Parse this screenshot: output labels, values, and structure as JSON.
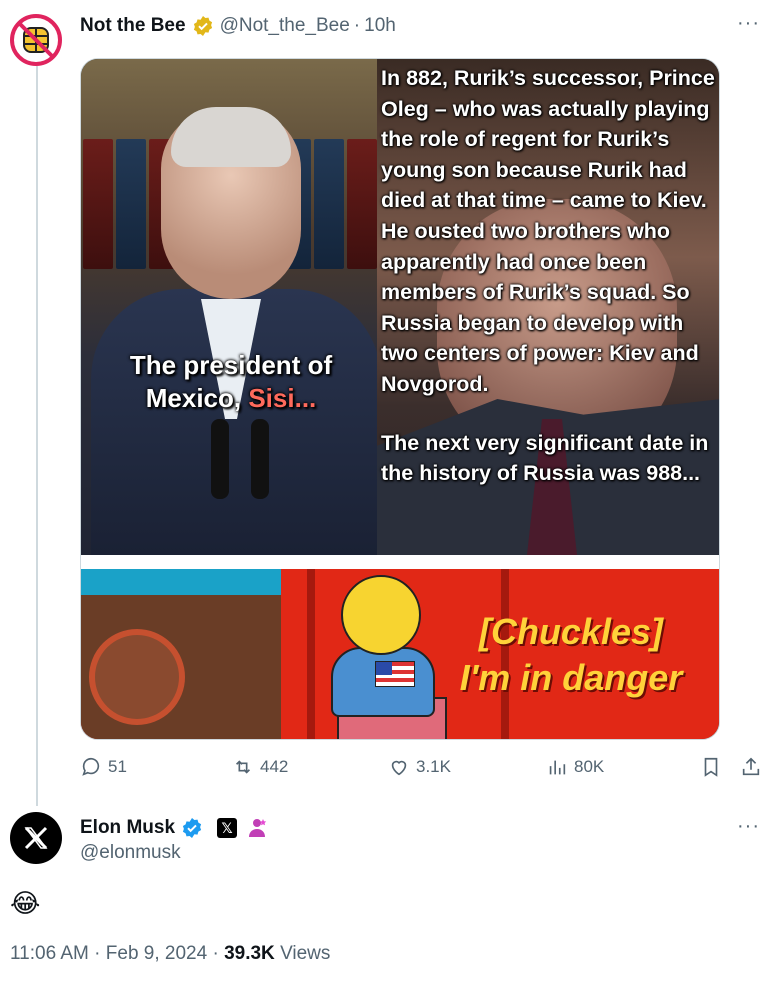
{
  "quoted": {
    "name": "Not the Bee",
    "handle": "@Not_the_Bee",
    "separator": "·",
    "time": "10h",
    "more": "···",
    "media": {
      "caption_left_1": "The president of",
      "caption_left_2": "Mexico,",
      "caption_left_highlight": "Sisi...",
      "caption_right_1": "In 882, Rurik’s successor, Prince Oleg – who was actually playing the role of regent for Rurik’s young son because Rurik had died at that time – came to Kiev. He ousted two brothers who apparently had once been members of Rurik’s squad. So Russia began to develop with two centers of power: Kiev and Novgorod.",
      "caption_right_2": "The next very significant date in the history of Russia was 988...",
      "meme_line_1": "[Chuckles]",
      "meme_line_2": "I'm in danger"
    },
    "stats": {
      "replies": "51",
      "reposts": "442",
      "likes": "3.1K",
      "views": "80K"
    }
  },
  "tweet": {
    "name": "Elon Musk",
    "x_badge": "𝕏",
    "handle": "@elonmusk",
    "more": "···",
    "text": "😂",
    "time": "11:06 AM",
    "date": "Feb 9, 2024",
    "views_count": "39.3K",
    "views_label": "Views",
    "dot": "·"
  },
  "colors": {
    "verified_gold": "#e2b719",
    "verified_blue": "#1d9bf0",
    "meme_red": "#e12816",
    "meme_yellow": "#ffd23a",
    "muted": "#536471"
  },
  "icons": [
    "reply-icon",
    "repost-icon",
    "like-icon",
    "views-icon",
    "bookmark-icon",
    "share-icon",
    "x-logo-icon",
    "bee-logo-icon"
  ]
}
